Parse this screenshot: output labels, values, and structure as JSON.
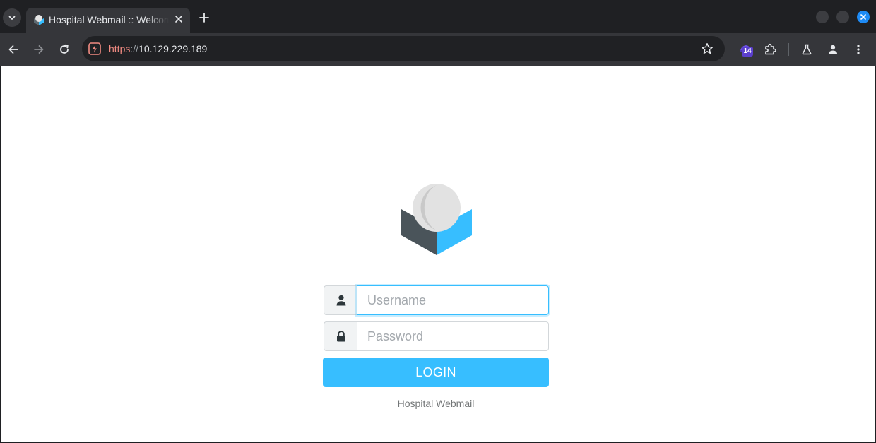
{
  "browser": {
    "tab": {
      "title": "Hospital Webmail :: Welcome to Hospital Webmail"
    },
    "address_bar": {
      "scheme": "https",
      "separator": "://",
      "host": "10.129.229.189"
    },
    "extension_badge": "14",
    "accent_color": "#37beff"
  },
  "page": {
    "username": {
      "placeholder": "Username",
      "value": ""
    },
    "password": {
      "placeholder": "Password",
      "value": ""
    },
    "login_label": "LOGIN",
    "footer": "Hospital Webmail"
  }
}
